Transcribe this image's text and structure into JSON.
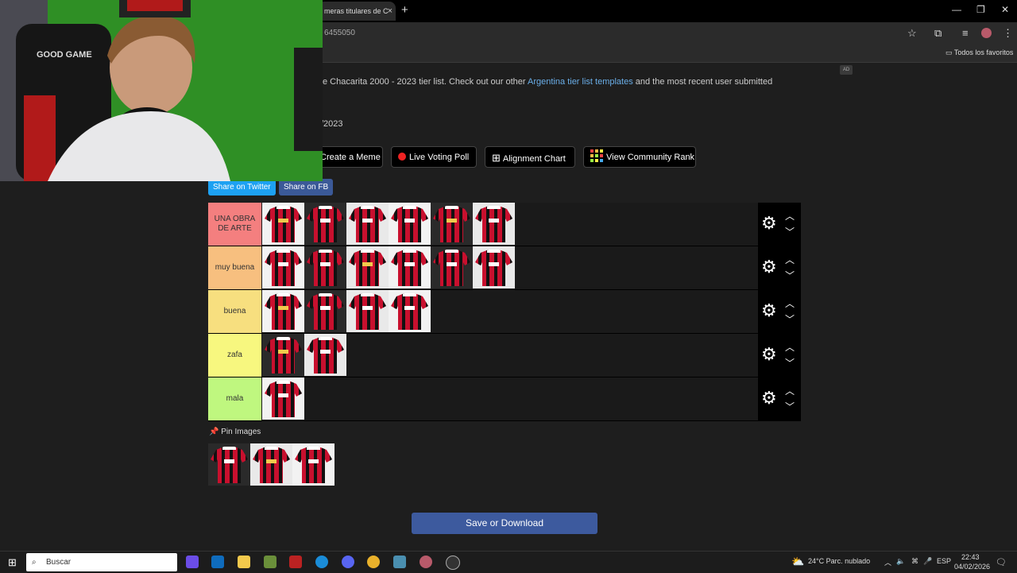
{
  "browser": {
    "tab_title": "meras titulares de C",
    "tab_close": "×",
    "new_tab": "+",
    "url": "6455050",
    "bookmark_folder": "Todos los favoritos"
  },
  "page": {
    "ad_badge": "AD",
    "intro_text": "e Chacarita 2000 - 2023 tier list. Check out our other ",
    "intro_link": "Argentina tier list templates",
    "intro_text2": " and the most recent user submitted",
    "year_text": "/2023",
    "buttons": {
      "meme": "Create a Meme",
      "poll": "Live Voting Poll",
      "alignment": "Alignment Chart",
      "community": "View Community Rank"
    },
    "share_twitter": "Share on Twitter",
    "share_fb": "Share on FB",
    "tiers": [
      {
        "label": "UNA OBRA DE ARTE",
        "color": "#f47f7f",
        "count": 6
      },
      {
        "label": "muy buena",
        "color": "#f7bf7f",
        "count": 6
      },
      {
        "label": "buena",
        "color": "#f7df7f",
        "count": 4
      },
      {
        "label": "zafa",
        "color": "#f7f77f",
        "count": 2
      },
      {
        "label": "mala",
        "color": "#bff77f",
        "count": 1
      }
    ],
    "pin_label": "Pin Images",
    "save_button": "Save or Download"
  },
  "taskbar": {
    "search_placeholder": "Buscar",
    "weather": "24°C  Parc. nublado",
    "lang": "ESP",
    "time": "22:43",
    "date": "04/02/2026"
  },
  "colors": {
    "accent_link": "#6aaee8",
    "twitter": "#1da1f2",
    "facebook": "#3b5998",
    "save": "#3d5a9e"
  }
}
